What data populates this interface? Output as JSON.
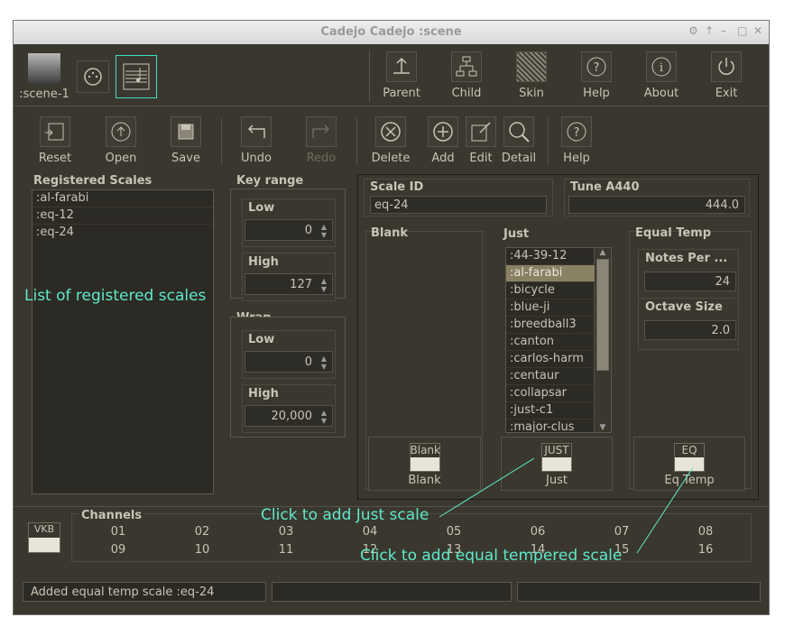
{
  "window": {
    "title": "Cadejo Cadejo :scene"
  },
  "scene_tab": {
    "label": ":scene-1"
  },
  "top_toolbar": [
    {
      "label": "Parent"
    },
    {
      "label": "Child"
    },
    {
      "label": "Skin"
    },
    {
      "label": "Help"
    },
    {
      "label": "About"
    },
    {
      "label": "Exit"
    }
  ],
  "edit_toolbar": {
    "reset": "Reset",
    "open": "Open",
    "save": "Save",
    "undo": "Undo",
    "redo": "Redo",
    "delete": "Delete",
    "add": "Add",
    "edit": "Edit",
    "detail": "Detail",
    "help": "Help"
  },
  "registered": {
    "title": "Registered Scales",
    "items": [
      ":al-farabi",
      ":eq-12",
      ":eq-24"
    ],
    "annotation": "List of registered scales"
  },
  "key_range": {
    "title": "Key range",
    "low_label": "Low",
    "low_value": "0",
    "high_label": "High",
    "high_value": "127"
  },
  "wrap": {
    "title": "Wrap",
    "low_label": "Low",
    "low_value": "0",
    "high_label": "High",
    "high_value": "20,000"
  },
  "scale_id": {
    "label": "Scale ID",
    "value": "eq-24"
  },
  "tune": {
    "label": "Tune A440",
    "value": "444.0"
  },
  "blank": {
    "title": "Blank",
    "button_icon_text": "Blank",
    "button_label": "Blank"
  },
  "just": {
    "title": "Just",
    "items": [
      ":44-39-12",
      ":al-farabi",
      ":bicycle",
      ":blue-ji",
      ":breedball3",
      ":canton",
      ":carlos-harm",
      ":centaur",
      ":collapsar",
      ":just-c1",
      ":major-clus"
    ],
    "selected_index": 1,
    "button_icon_text": "JUST",
    "button_label": "Just"
  },
  "equal_temp": {
    "title": "Equal Temp",
    "notes_label": "Notes Per ...",
    "notes_value": "24",
    "octave_label": "Octave Size",
    "octave_value": "2.0",
    "button_icon_text": "EQ",
    "button_label": "Eq Temp"
  },
  "channels": {
    "title": "Channels",
    "vkb": "VKB",
    "row1": [
      "01",
      "02",
      "03",
      "04",
      "05",
      "06",
      "07",
      "08"
    ],
    "row2": [
      "09",
      "10",
      "11",
      "12",
      "13",
      "14",
      "15",
      "16"
    ]
  },
  "annotations": {
    "just": "Click to add Just scale",
    "eq": "Click to add equal tempered scale"
  },
  "status": {
    "message": "Added equal temp scale :eq-24"
  },
  "colors": {
    "background": "#3a372f",
    "annotation": "#5fe9c9",
    "selection": "#8a8064"
  }
}
